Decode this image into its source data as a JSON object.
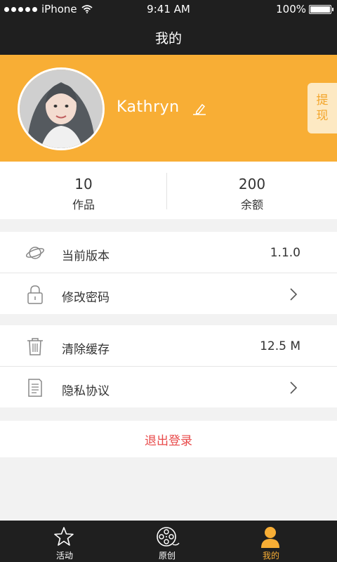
{
  "status_bar": {
    "carrier": "iPhone",
    "time": "9:41 AM",
    "battery": "100%"
  },
  "nav": {
    "title": "我的"
  },
  "profile": {
    "username": "Kathryn",
    "withdraw_label": "提现"
  },
  "stats": [
    {
      "value": "10",
      "label": "作品"
    },
    {
      "value": "200",
      "label": "余额"
    }
  ],
  "settings": {
    "version": {
      "label": "当前版本",
      "value": "1.1.0"
    },
    "change_password": {
      "label": "修改密码"
    },
    "clear_cache": {
      "label": "清除缓存",
      "value": "12.5 M"
    },
    "privacy": {
      "label": "隐私协议"
    }
  },
  "logout_label": "退出登录",
  "tabs": [
    {
      "label": "活动",
      "icon": "star-icon",
      "active": false
    },
    {
      "label": "原创",
      "icon": "film-reel-icon",
      "active": false
    },
    {
      "label": "我的",
      "icon": "person-icon",
      "active": true
    }
  ],
  "colors": {
    "accent": "#f8ae35",
    "dark": "#1f1f1f",
    "logout": "#e84a4a"
  }
}
